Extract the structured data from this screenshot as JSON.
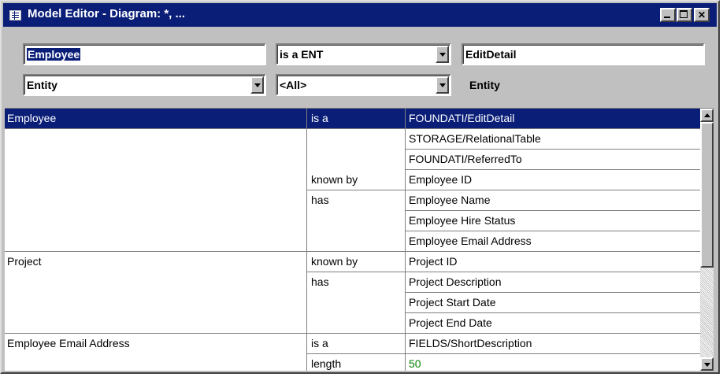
{
  "window": {
    "title": "Model Editor - Diagram: *, ...",
    "icon": "grid-window-icon",
    "controls": [
      "minimize-icon",
      "maximize-icon",
      "close-icon"
    ]
  },
  "header": {
    "name_value": "Employee",
    "relationship_value": "is a ENT",
    "target_value": "EditDetail",
    "type_value": "Entity",
    "filter_value": "<All>",
    "target_type_value": "Entity"
  },
  "colors": {
    "selection": "#0a1e78",
    "value_green": "#008000",
    "window_bg": "#c0c0c0"
  },
  "rows": [
    {
      "object": "Employee",
      "relation": "is a",
      "value": "FOUNDATI/EditDetail",
      "selected": true
    },
    {
      "object": "",
      "relation": "",
      "value": "STORAGE/RelationalTable"
    },
    {
      "object": "",
      "relation": "",
      "value": "FOUNDATI/ReferredTo"
    },
    {
      "object": "",
      "relation": "known by",
      "value": "Employee ID"
    },
    {
      "object": "",
      "relation": "has",
      "value": "Employee Name"
    },
    {
      "object": "",
      "relation": "",
      "value": "Employee Hire Status"
    },
    {
      "object": "",
      "relation": "",
      "value": "Employee Email Address"
    },
    {
      "object": "Project",
      "relation": "known by",
      "value": "Project ID"
    },
    {
      "object": "",
      "relation": "has",
      "value": "Project Description"
    },
    {
      "object": "",
      "relation": "",
      "value": "Project Start Date"
    },
    {
      "object": "",
      "relation": "",
      "value": "Project End Date"
    },
    {
      "object": "Employee Email Address",
      "relation": "is a",
      "value": "FIELDS/ShortDescription"
    },
    {
      "object": "",
      "relation": "length",
      "value": "50",
      "value_color": "green"
    }
  ]
}
